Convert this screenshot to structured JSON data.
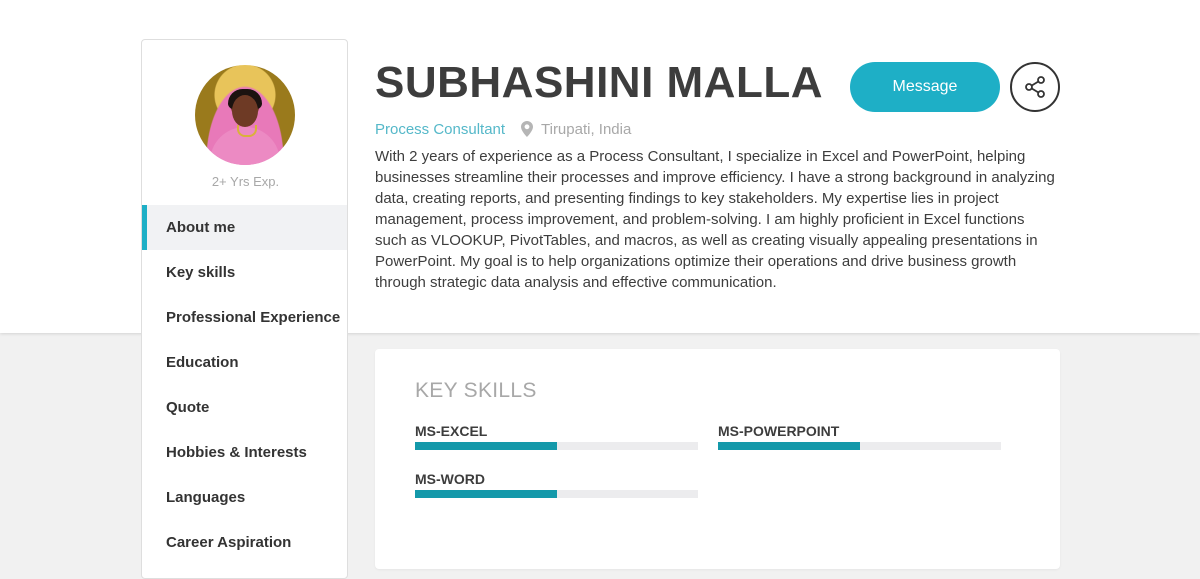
{
  "profile": {
    "name": "SUBHASHINI MALLA",
    "role": "Process Consultant",
    "location": "Tirupati, India",
    "experience": "2+ Yrs Exp.",
    "about": "With 2 years of experience as a Process Consultant, I specialize in Excel and PowerPoint, helping businesses streamline their processes and improve efficiency. I have a strong background in analyzing data, creating reports, and presenting findings to key stakeholders. My expertise lies in project management, process improvement, and problem-solving. I am highly proficient in Excel functions such as VLOOKUP, PivotTables, and macros, as well as creating visually appealing presentations in PowerPoint. My goal is to help organizations optimize their operations and drive business growth through strategic data analysis and effective communication."
  },
  "actions": {
    "message_label": "Message",
    "share_icon": "share-icon"
  },
  "sidebar": {
    "items": [
      {
        "label": "About me",
        "active": true
      },
      {
        "label": "Key skills",
        "active": false
      },
      {
        "label": "Professional Experience",
        "active": false
      },
      {
        "label": "Education",
        "active": false
      },
      {
        "label": "Quote",
        "active": false
      },
      {
        "label": "Hobbies & Interests",
        "active": false
      },
      {
        "label": "Languages",
        "active": false
      },
      {
        "label": "Career Aspiration",
        "active": false
      }
    ]
  },
  "skills": {
    "title": "KEY SKILLS",
    "items": [
      {
        "name": "MS-EXCEL",
        "level_percent": 50
      },
      {
        "name": "MS-POWERPOINT",
        "level_percent": 50
      },
      {
        "name": "MS-WORD",
        "level_percent": 50
      }
    ]
  },
  "colors": {
    "accent": "#1eafc6",
    "skill_fill": "#1499aa",
    "role_text": "#55b8c9"
  }
}
